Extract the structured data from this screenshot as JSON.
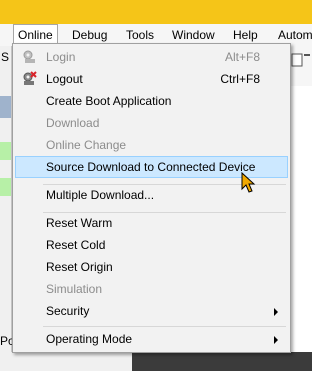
{
  "menubar": {
    "items": [
      "Online",
      "Debug",
      "Tools",
      "Window",
      "Help",
      "Autom"
    ]
  },
  "background": {
    "frag_s": "S",
    "frag_po": "Po"
  },
  "online_menu": {
    "items": [
      {
        "label": "Login",
        "shortcut": "Alt+F8",
        "disabled": true,
        "icon": "login-icon"
      },
      {
        "label": "Logout",
        "shortcut": "Ctrl+F8",
        "disabled": false,
        "icon": "logout-icon"
      },
      {
        "label": "Create Boot Application",
        "disabled": false
      },
      {
        "label": "Download",
        "disabled": true
      },
      {
        "label": "Online Change",
        "disabled": true
      },
      {
        "label": "Source Download to Connected Device",
        "disabled": false,
        "highlighted": true
      },
      {
        "label": "Multiple Download...",
        "disabled": false
      },
      {
        "label": "Reset Warm",
        "disabled": false
      },
      {
        "label": "Reset Cold",
        "disabled": false
      },
      {
        "label": "Reset Origin",
        "disabled": false
      },
      {
        "label": "Simulation",
        "disabled": true
      },
      {
        "label": "Security",
        "disabled": false,
        "submenu": true
      },
      {
        "label": "Operating Mode",
        "disabled": false,
        "submenu": true
      }
    ]
  },
  "colors": {
    "title_bar": "#f5c518",
    "highlight_bg": "#cce8ff",
    "highlight_border": "#99d1ff",
    "disabled_text": "#8c8c8c"
  }
}
